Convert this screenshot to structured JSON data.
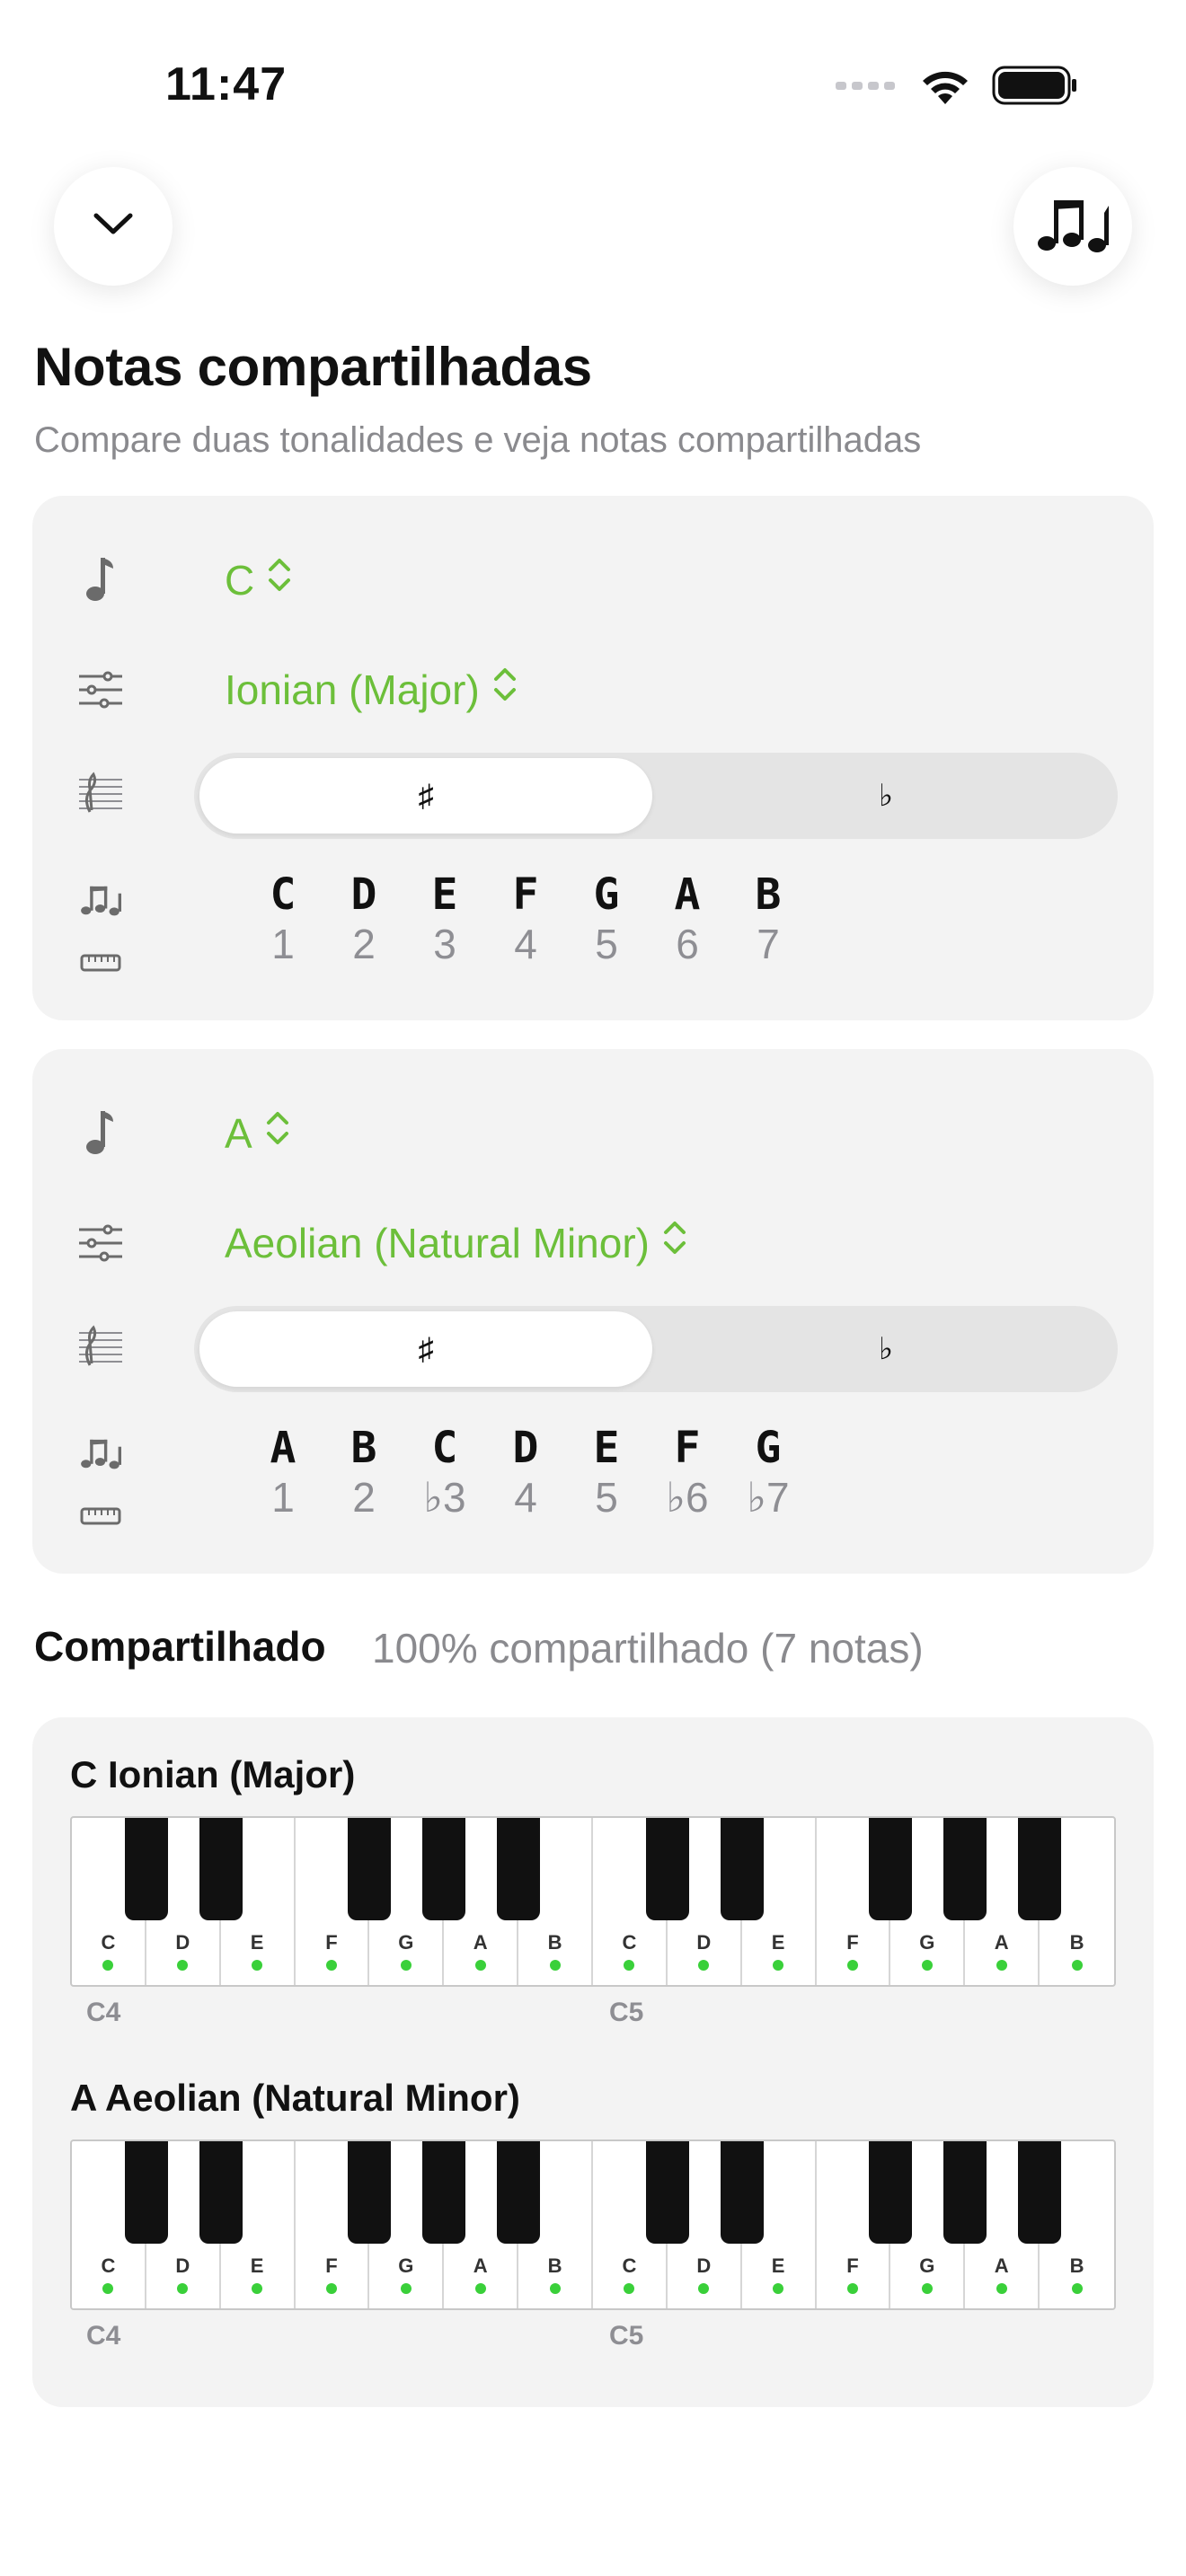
{
  "status": {
    "time": "11:47"
  },
  "header": {
    "title": "Notas compartilhadas",
    "subtitle": "Compare duas tonalidades e veja notas compartilhadas"
  },
  "icons": {
    "back": "chevron-down-icon",
    "notes": "music-notes-icon",
    "key": "eighth-note-icon",
    "mode": "sliders-icon",
    "accidental": "treble-clef-icon",
    "notes_row": "music-notes-icon",
    "degree_row": "ruler-icon"
  },
  "accent_color": "#6cbf3a",
  "cards": [
    {
      "key": "C",
      "mode": "Ionian (Major)",
      "accidentals": {
        "sharp": "♯",
        "flat": "♭",
        "selected": "sharp"
      },
      "notes": [
        "C",
        "D",
        "E",
        "F",
        "G",
        "A",
        "B"
      ],
      "degrees": [
        "1",
        "2",
        "3",
        "4",
        "5",
        "6",
        "7"
      ]
    },
    {
      "key": "A",
      "mode": "Aeolian (Natural Minor)",
      "accidentals": {
        "sharp": "♯",
        "flat": "♭",
        "selected": "sharp"
      },
      "notes": [
        "A",
        "B",
        "C",
        "D",
        "E",
        "F",
        "G"
      ],
      "degrees": [
        "1",
        "2",
        "♭3",
        "4",
        "5",
        "♭6",
        "♭7"
      ]
    }
  ],
  "shared": {
    "title": "Compartilhado",
    "summary": "100% compartilhado (7 notas)"
  },
  "keyboards": [
    {
      "label": "C Ionian (Major)",
      "keys": [
        "C",
        "D",
        "E",
        "F",
        "G",
        "A",
        "B",
        "C",
        "D",
        "E",
        "F",
        "G",
        "A",
        "B"
      ],
      "highlighted": [
        true,
        true,
        true,
        true,
        true,
        true,
        true,
        true,
        true,
        true,
        true,
        true,
        true,
        true
      ],
      "octaves": [
        "C4",
        "C5"
      ]
    },
    {
      "label": "A Aeolian (Natural Minor)",
      "keys": [
        "C",
        "D",
        "E",
        "F",
        "G",
        "A",
        "B",
        "C",
        "D",
        "E",
        "F",
        "G",
        "A",
        "B"
      ],
      "highlighted": [
        true,
        true,
        true,
        true,
        true,
        true,
        true,
        true,
        true,
        true,
        true,
        true,
        true,
        true
      ],
      "octaves": [
        "C4",
        "C5"
      ]
    }
  ]
}
